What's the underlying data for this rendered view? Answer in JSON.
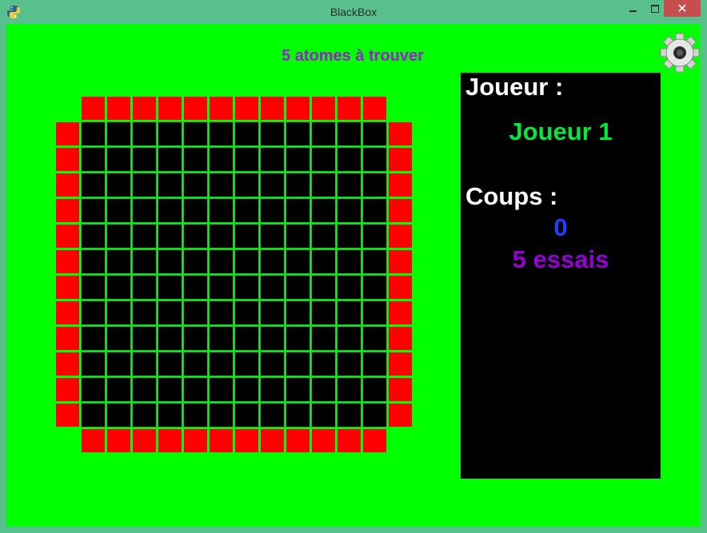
{
  "window": {
    "title": "BlackBox",
    "close_glyph": "✕"
  },
  "game": {
    "atoms_label": "5 atomes à trouver",
    "grid_size": 12,
    "colors": {
      "background": "#00ff00",
      "inner_cell": "#000000",
      "grid_line": "#22b833",
      "edge_cell": "#ff0000",
      "panel": "#000000"
    }
  },
  "panel": {
    "player_heading": "Joueur :",
    "player_name": "Joueur 1",
    "moves_heading": "Coups :",
    "moves_count": "0",
    "tries_label": "5 essais"
  },
  "icons": {
    "app": "python-icon",
    "settings": "gear-icon"
  }
}
